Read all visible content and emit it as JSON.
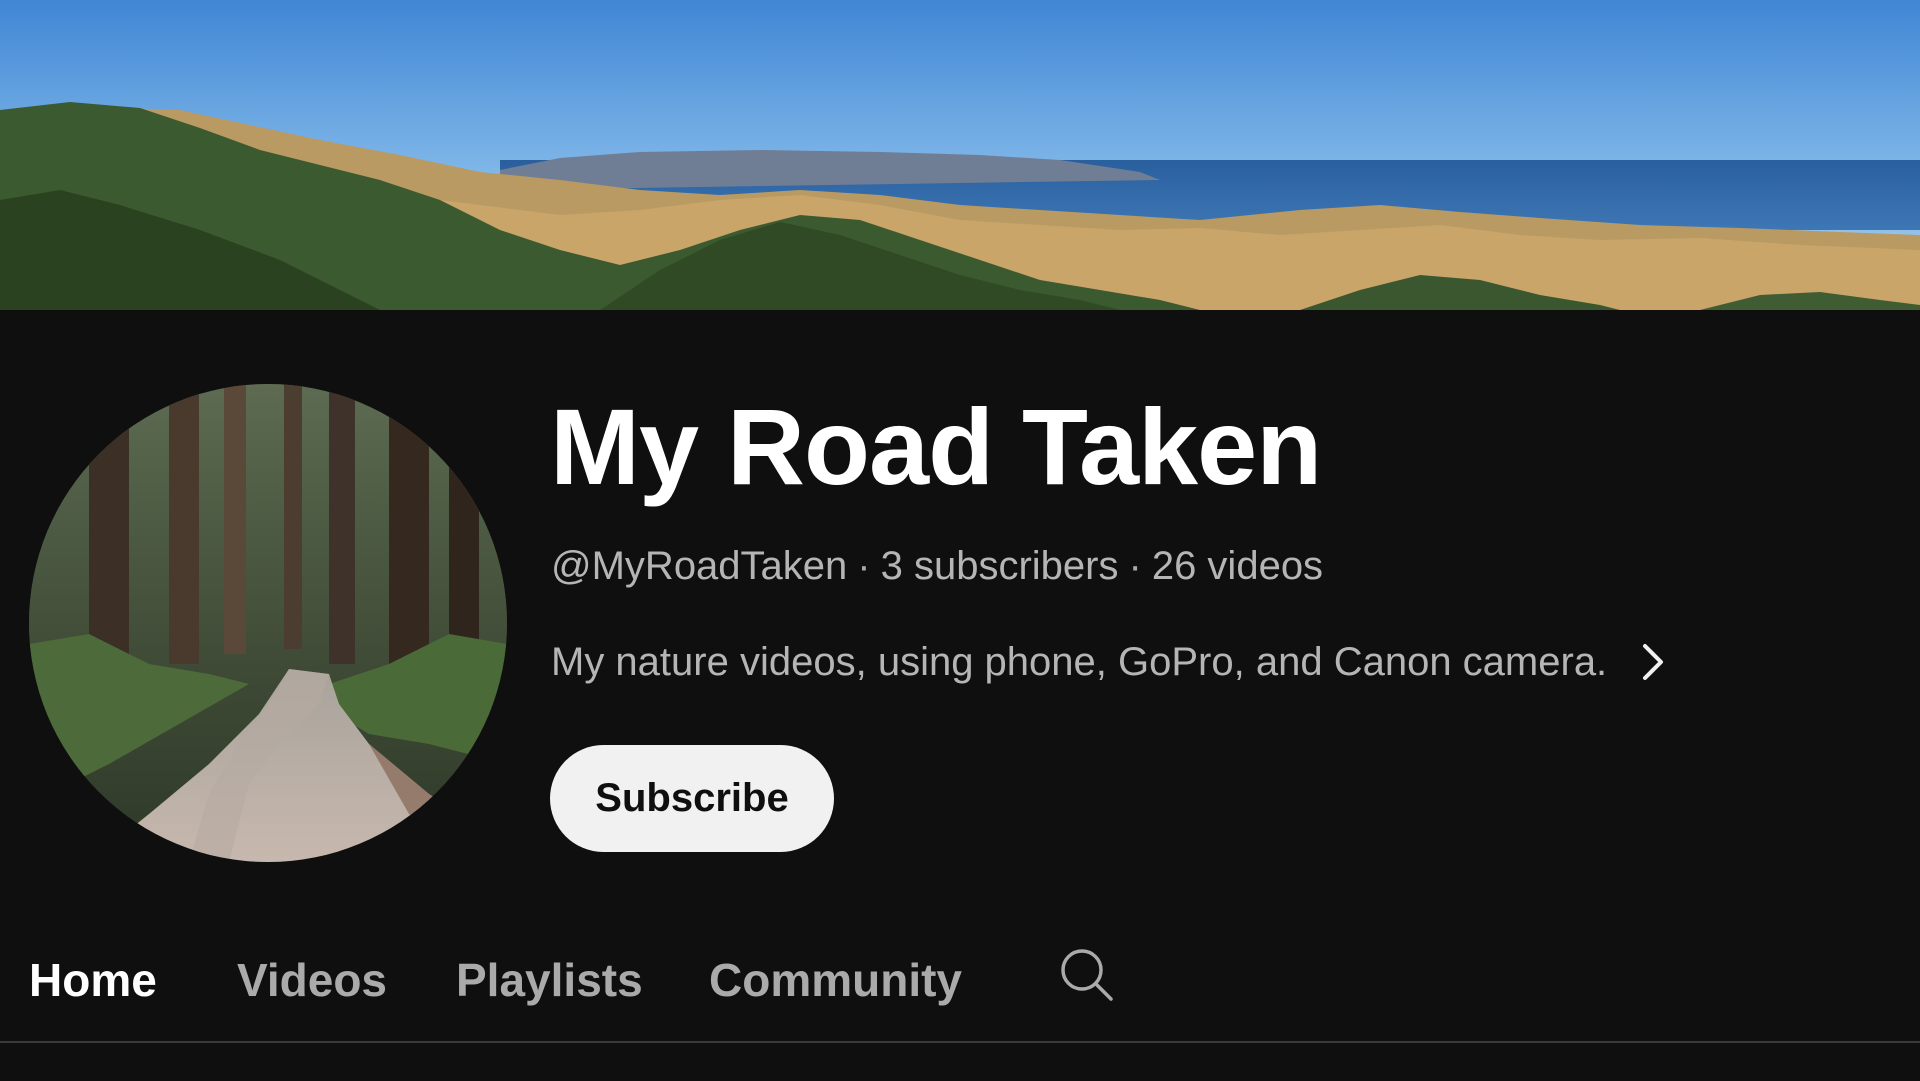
{
  "channel": {
    "name": "My Road Taken",
    "handle": "@MyRoadTaken",
    "subscribers": "3 subscribers",
    "videos": "26 videos",
    "separator": "·",
    "description": "My nature videos, using phone, GoPro, and Canon camera."
  },
  "actions": {
    "subscribe_label": "Subscribe"
  },
  "tabs": [
    {
      "label": "Home",
      "active": true
    },
    {
      "label": "Videos",
      "active": false
    },
    {
      "label": "Playlists",
      "active": false
    },
    {
      "label": "Community",
      "active": false
    }
  ],
  "icons": {
    "description_more": "chevron-right-icon",
    "tab_search": "search-icon"
  },
  "colors": {
    "background": "#0f0f0f",
    "title": "#ffffff",
    "secondary_text": "#aaaaaa",
    "subscribe_bg": "#f1f1f1",
    "subscribe_text": "#0f0f0f"
  }
}
